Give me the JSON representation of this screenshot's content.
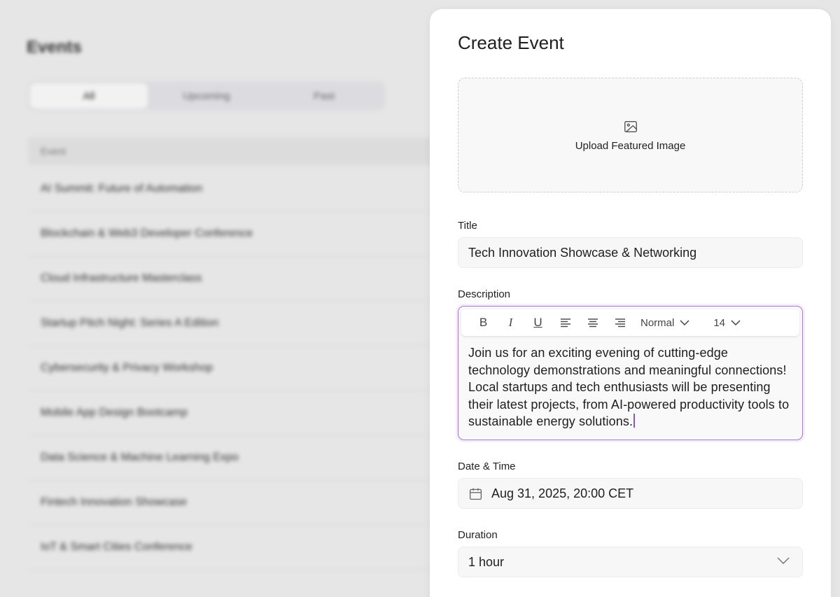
{
  "background": {
    "title": "Events",
    "tabs": [
      "All",
      "Upcoming",
      "Past"
    ],
    "table_header": "Event",
    "rows": [
      "AI Summit: Future of Automation",
      "Blockchain & Web3 Developer Conference",
      "Cloud Infrastructure Masterclass",
      "Startup Pitch Night: Series A Edition",
      "Cybersecurity & Privacy Workshop",
      "Mobile App Design Bootcamp",
      "Data Science & Machine Learning Expo",
      "Fintech Innovation Showcase",
      "IoT & Smart Cities Conference"
    ]
  },
  "modal": {
    "title": "Create Event",
    "upload_label": "Upload Featured Image",
    "title_label": "Title",
    "title_value": "Tech Innovation Showcase & Networking",
    "description_label": "Description",
    "toolbar": {
      "bold": "B",
      "italic": "I",
      "underline": "U",
      "text_style": "Normal",
      "font_size": "14"
    },
    "description_value": "Join us for an exciting evening of cutting-edge technology demonstrations and meaningful connections! Local startups and tech enthusiasts will be presenting their latest projects, from AI-powered productivity tools to sustainable energy solutions.",
    "datetime_label": "Date & Time",
    "datetime_value": "Aug 31, 2025, 20:00 CET",
    "duration_label": "Duration",
    "duration_value": "1 hour"
  },
  "colors": {
    "accent": "#a77ad6",
    "caret": "#8a55c8"
  }
}
